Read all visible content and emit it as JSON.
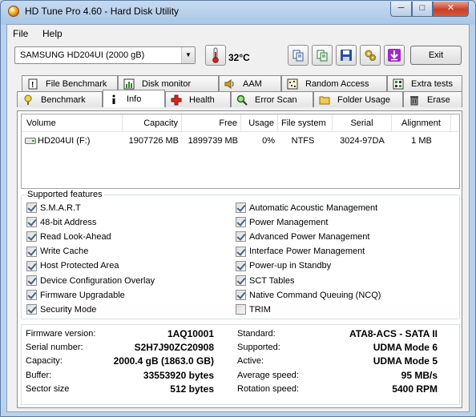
{
  "window": {
    "title": "HD Tune Pro 4.60 - Hard Disk Utility",
    "minimize": "─",
    "maximize": "□",
    "close": "✕"
  },
  "menu": {
    "file": "File",
    "help": "Help"
  },
  "toolbar": {
    "drive": "SAMSUNG HD204UI (2000 gB)",
    "temperature": "32°C",
    "exit": "Exit"
  },
  "tabs_row1": [
    {
      "label": "File Benchmark",
      "icon": "file-benchmark-icon"
    },
    {
      "label": "Disk monitor",
      "icon": "disk-monitor-icon"
    },
    {
      "label": "AAM",
      "icon": "speaker-icon"
    },
    {
      "label": "Random Access",
      "icon": "random-access-icon"
    },
    {
      "label": "Extra tests",
      "icon": "extra-tests-icon"
    }
  ],
  "tabs_row2": [
    {
      "label": "Benchmark",
      "icon": "benchmark-icon"
    },
    {
      "label": "Info",
      "icon": "info-icon",
      "active": true
    },
    {
      "label": "Health",
      "icon": "health-icon"
    },
    {
      "label": "Error Scan",
      "icon": "error-scan-icon"
    },
    {
      "label": "Folder Usage",
      "icon": "folder-icon"
    },
    {
      "label": "Erase",
      "icon": "erase-icon"
    }
  ],
  "volumes": {
    "headers": [
      "Volume",
      "Capacity",
      "Free",
      "Usage",
      "File system",
      "Serial",
      "Alignment"
    ],
    "rows": [
      {
        "volume": "HD204UI (F:)",
        "capacity": "1907726 MB",
        "free": "1899739 MB",
        "usage": "0%",
        "fs": "NTFS",
        "serial": "3024-97DA",
        "alignment": "1 MB"
      }
    ]
  },
  "features": {
    "label": "Supported features",
    "left": [
      {
        "label": "S.M.A.R.T",
        "checked": true
      },
      {
        "label": "48-bit Address",
        "checked": true
      },
      {
        "label": "Read Look-Ahead",
        "checked": true
      },
      {
        "label": "Write Cache",
        "checked": true
      },
      {
        "label": "Host Protected Area",
        "checked": true
      },
      {
        "label": "Device Configuration Overlay",
        "checked": true
      },
      {
        "label": "Firmware Upgradable",
        "checked": true
      },
      {
        "label": "Security Mode",
        "checked": true
      }
    ],
    "right": [
      {
        "label": "Automatic Acoustic Management",
        "checked": true
      },
      {
        "label": "Power Management",
        "checked": true
      },
      {
        "label": "Advanced Power Management",
        "checked": true
      },
      {
        "label": "Interface Power Management",
        "checked": true
      },
      {
        "label": "Power-up in Standby",
        "checked": true
      },
      {
        "label": "SCT Tables",
        "checked": true
      },
      {
        "label": "Native Command Queuing (NCQ)",
        "checked": true
      },
      {
        "label": "TRIM",
        "checked": false
      }
    ]
  },
  "details": {
    "left": [
      {
        "label": "Firmware version:",
        "value": "1AQ10001"
      },
      {
        "label": "Serial number:",
        "value": "S2H7J90ZC20908"
      },
      {
        "label": "Capacity:",
        "value": "2000.4 gB (1863.0 GB)"
      },
      {
        "label": "Buffer:",
        "value": "33553920 bytes"
      },
      {
        "label": "Sector size",
        "value": "512 bytes"
      }
    ],
    "right": [
      {
        "label": "Standard:",
        "value": "ATA8-ACS - SATA II"
      },
      {
        "label": "Supported:",
        "value": "UDMA Mode 6"
      },
      {
        "label": "Active:",
        "value": "UDMA Mode 5"
      },
      {
        "label": "Average speed:",
        "value": "95 MB/s"
      },
      {
        "label": "Rotation speed:",
        "value": "5400 RPM"
      }
    ]
  }
}
